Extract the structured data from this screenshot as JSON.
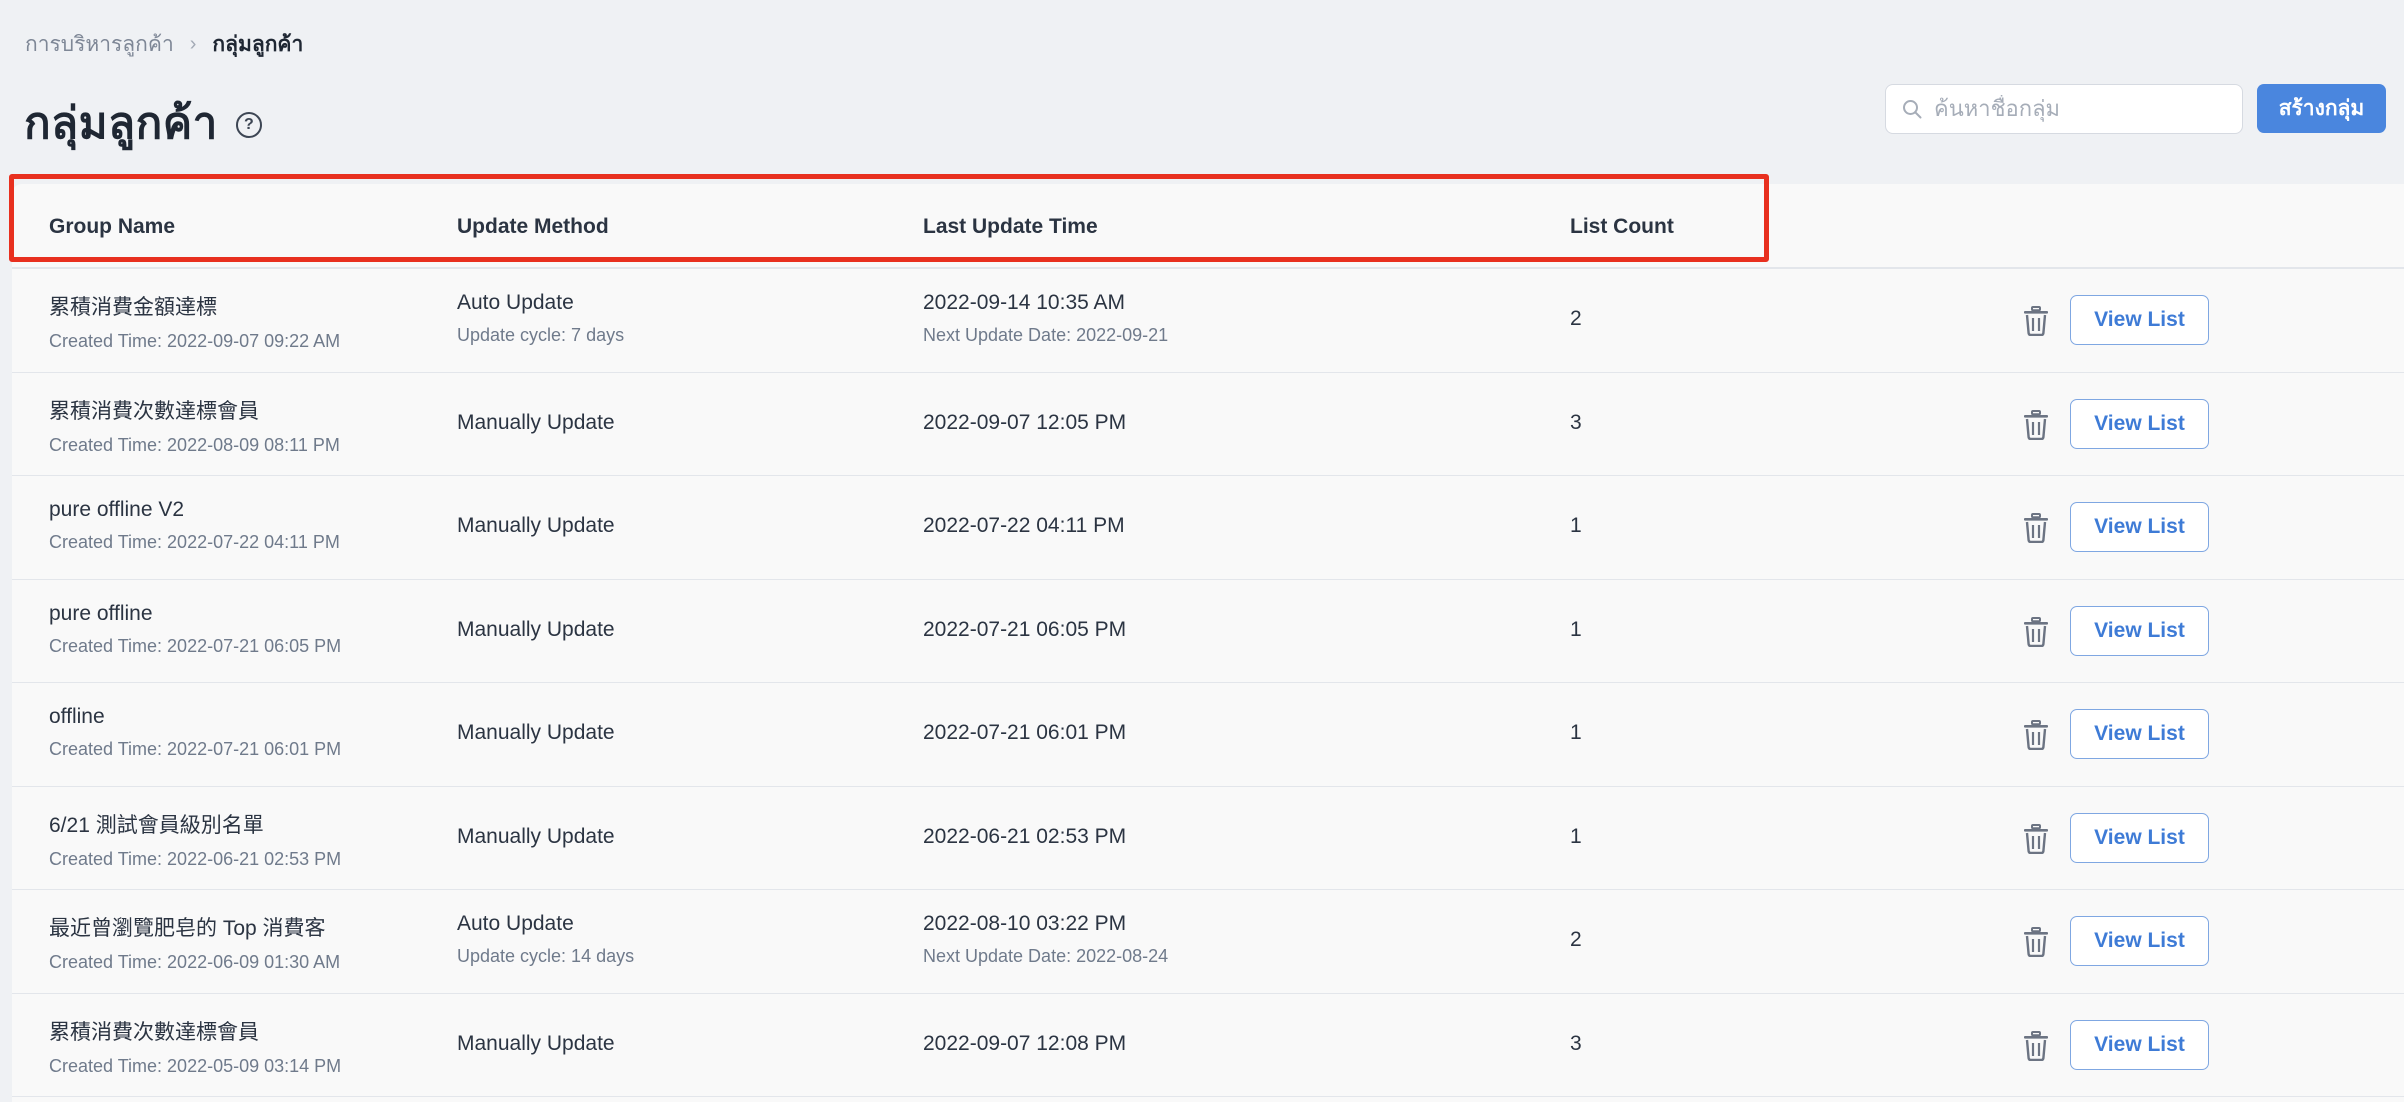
{
  "breadcrumb": {
    "parent": "การบริหารลูกค้า",
    "separator": "›",
    "current": "กลุ่มลูกค้า"
  },
  "page": {
    "title": "กลุ่มลูกค้า",
    "help_icon": "?"
  },
  "search": {
    "placeholder": "ค้นหาชื่อกลุ่ม",
    "value": ""
  },
  "create_button": "สร้างกลุ่ม",
  "table": {
    "headers": {
      "group_name": "Group Name",
      "update_method": "Update Method",
      "last_update_time": "Last Update Time",
      "list_count": "List Count"
    },
    "view_button_label": "View List",
    "rows": [
      {
        "name": "累積消費金額達標",
        "created": "Created Time: 2022-09-07 09:22 AM",
        "method": "Auto Update",
        "method_sub": "Update cycle: 7 days",
        "time": "2022-09-14 10:35 AM",
        "time_sub": "Next Update Date: 2022-09-21",
        "count": "2"
      },
      {
        "name": "累積消費次數達標會員",
        "created": "Created Time: 2022-08-09 08:11 PM",
        "method": "Manually Update",
        "time": "2022-09-07 12:05 PM",
        "count": "3"
      },
      {
        "name": "pure offline V2",
        "created": "Created Time: 2022-07-22 04:11 PM",
        "method": "Manually Update",
        "time": "2022-07-22 04:11 PM",
        "count": "1"
      },
      {
        "name": "pure offline",
        "created": "Created Time: 2022-07-21 06:05 PM",
        "method": "Manually Update",
        "time": "2022-07-21 06:05 PM",
        "count": "1"
      },
      {
        "name": "offline",
        "created": "Created Time: 2022-07-21 06:01 PM",
        "method": "Manually Update",
        "time": "2022-07-21 06:01 PM",
        "count": "1"
      },
      {
        "name": "6/21 測試會員級別名單",
        "created": "Created Time: 2022-06-21 02:53 PM",
        "method": "Manually Update",
        "time": "2022-06-21 02:53 PM",
        "count": "1"
      },
      {
        "name": "最近曾瀏覽肥皂的 Top 消費客",
        "created": "Created Time: 2022-06-09 01:30 AM",
        "method": "Auto Update",
        "method_sub": "Update cycle: 14 days",
        "time": "2022-08-10 03:22 PM",
        "time_sub": "Next Update Date: 2022-08-24",
        "count": "2"
      },
      {
        "name": "累積消費次數達標會員",
        "created": "Created Time: 2022-05-09 03:14 PM",
        "method": "Manually Update",
        "time": "2022-09-07 12:08 PM",
        "count": "3"
      }
    ]
  },
  "colors": {
    "background": "#eff1f4",
    "accent": "#4a86de",
    "highlight": "#e8301f"
  },
  "icons": {
    "search": "search-icon",
    "help": "help-circle-icon",
    "delete": "trash-icon",
    "breadcrumb_sep": "chevron-right-icon"
  }
}
